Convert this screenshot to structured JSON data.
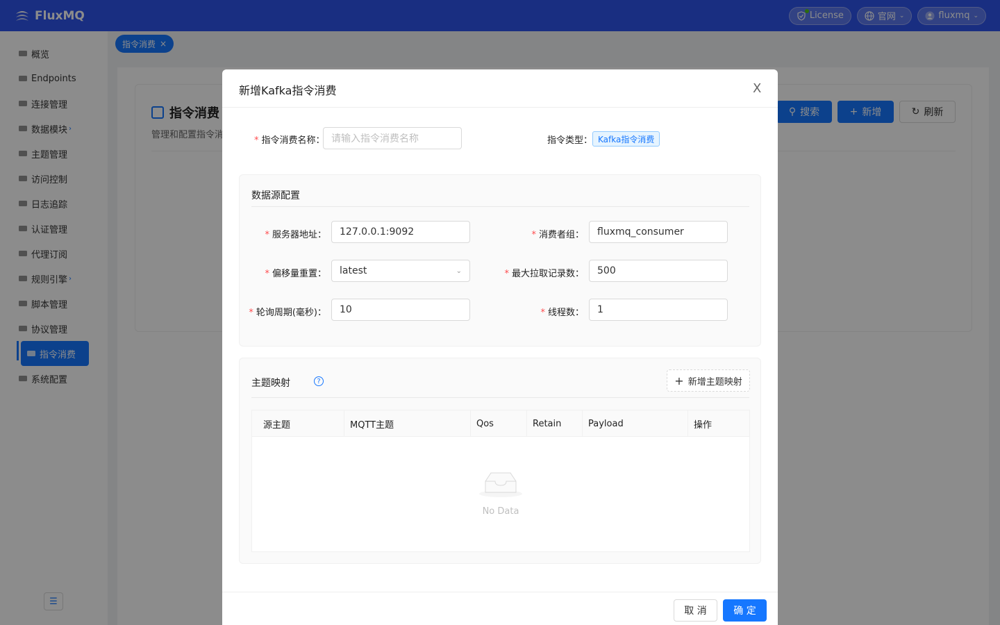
{
  "header": {
    "app_name": "FluxMQ",
    "license_label": "License",
    "site_label": "官网",
    "user_label": "fluxmq"
  },
  "sidebar": {
    "items": [
      {
        "label": "概览",
        "icon": "dashboard-icon"
      },
      {
        "label": "Endpoints",
        "icon": "globe-icon"
      },
      {
        "label": "连接管理",
        "icon": "connection-icon"
      },
      {
        "label": "数据模块",
        "icon": "database-icon",
        "has_sub": true
      },
      {
        "label": "主题管理",
        "icon": "hash-icon"
      },
      {
        "label": "访问控制",
        "icon": "lock-icon"
      },
      {
        "label": "日志追踪",
        "icon": "log-icon"
      },
      {
        "label": "认证管理",
        "icon": "auth-icon"
      },
      {
        "label": "代理订阅",
        "icon": "subscribe-icon"
      },
      {
        "label": "规则引擎",
        "icon": "rule-icon",
        "has_sub": true
      },
      {
        "label": "脚本管理",
        "icon": "script-icon"
      },
      {
        "label": "协议管理",
        "icon": "protocol-icon"
      },
      {
        "label": "指令消费",
        "icon": "consume-icon",
        "active": true
      },
      {
        "label": "系统配置",
        "icon": "settings-icon"
      }
    ],
    "arrow": "›",
    "collapse_icon": "collapse-menu-icon"
  },
  "tabbar": {
    "tab_label": "指令消费",
    "close": "×"
  },
  "page": {
    "title": "指令消费",
    "subtitle": "管理和配置指令消",
    "search_label": "搜索",
    "add_label": "新增",
    "refresh_label": "刷新"
  },
  "modal": {
    "title": "新增Kafka指令消费",
    "close": "X",
    "name_label": "指令消费名称：",
    "name_placeholder": "请输入指令消费名称",
    "type_label": "指令类型：",
    "type_value": "Kafka指令消费",
    "datasource": {
      "title": "数据源配置",
      "server_label": "服务器地址：",
      "server_value": "127.0.0.1:9092",
      "group_label": "消费者组：",
      "group_value": "fluxmq_consumer",
      "offset_label": "偏移量重置：",
      "offset_value": "latest",
      "max_label": "最大拉取记录数：",
      "max_value": "500",
      "poll_label": "轮询周期(毫秒)：",
      "poll_value": "10",
      "threads_label": "线程数：",
      "threads_value": "1"
    },
    "mapping": {
      "title": "主题映射",
      "help": "?",
      "add_label": "新增主题映射",
      "columns": [
        "源主题",
        "MQTT主题",
        "Qos",
        "Retain",
        "Payload",
        "操作"
      ],
      "empty_text": "No Data"
    },
    "cancel_label": "取 消",
    "ok_label": "确 定"
  },
  "colors": {
    "primary": "#1677ff",
    "header": "#2f54eb",
    "required": "#ff4d4f"
  }
}
